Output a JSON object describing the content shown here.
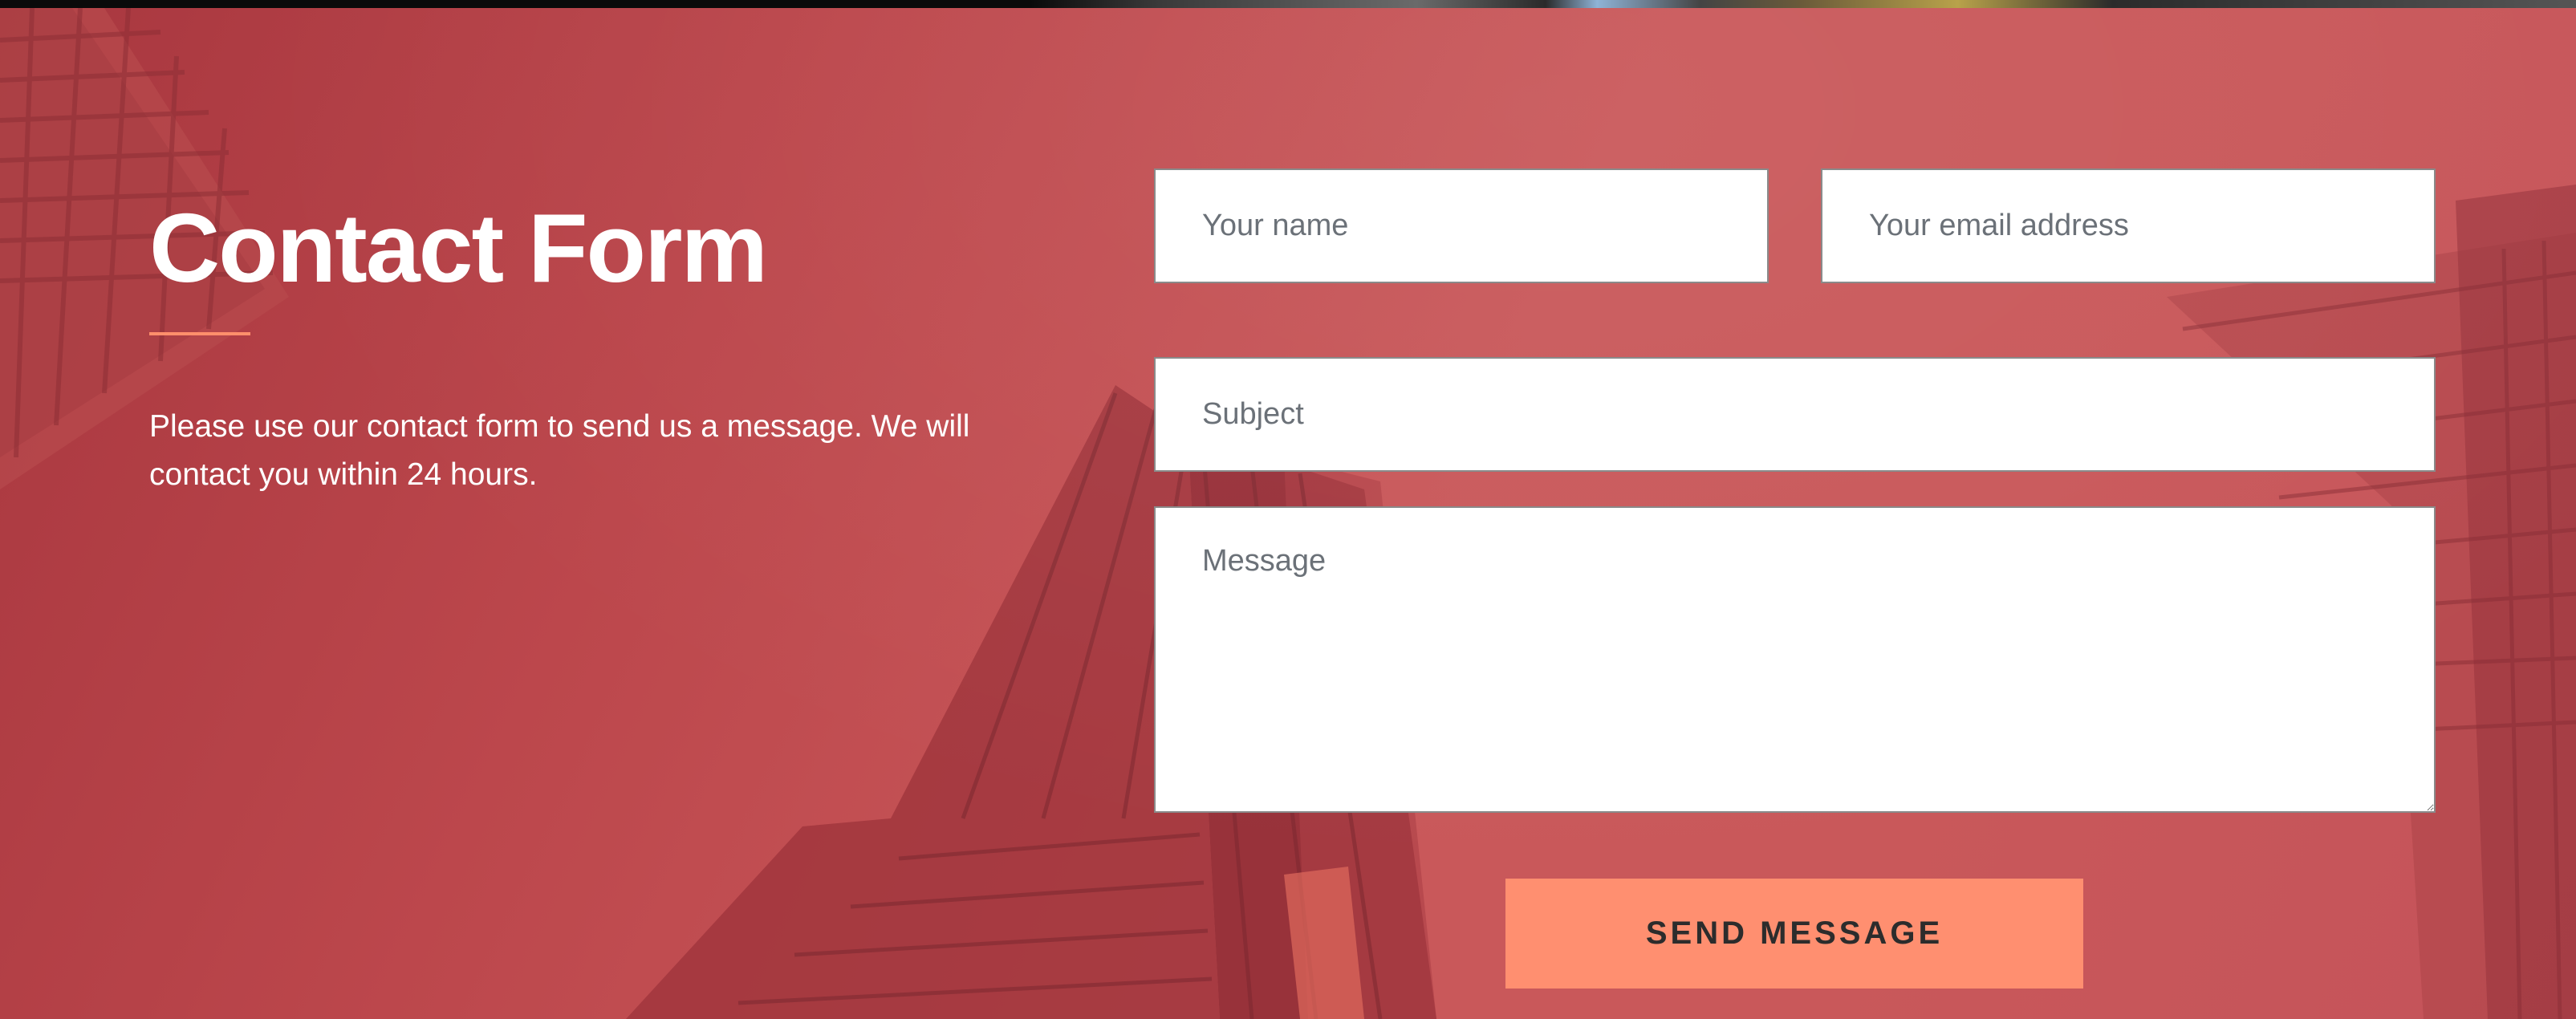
{
  "contact": {
    "title": "Contact Form",
    "intro": "Please use our contact form to send us a message. We will contact you within 24 hours."
  },
  "form": {
    "name_placeholder": "Your name",
    "email_placeholder": "Your email address",
    "subject_placeholder": "Subject",
    "message_placeholder": "Message",
    "send_label": "SEND MESSAGE"
  },
  "colors": {
    "overlay_red": "#c45052",
    "accent_orange": "#ff8f70",
    "title_white": "#ffffff"
  }
}
